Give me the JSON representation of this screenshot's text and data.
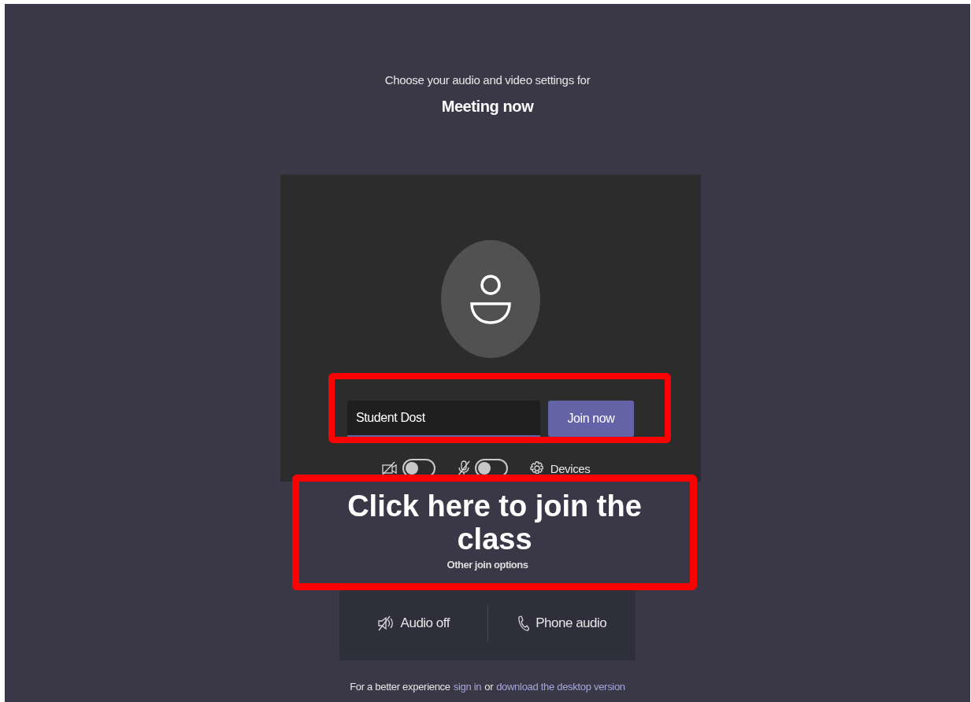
{
  "header": {
    "subtitle": "Choose your audio and video settings for",
    "title": "Meeting now"
  },
  "preview": {
    "name_field": {
      "value": "Student Dost"
    },
    "join_button": "Join now",
    "toggles": [
      {
        "kind": "camera",
        "on": false
      },
      {
        "kind": "mic",
        "on": false
      }
    ],
    "devices_button": "Devices"
  },
  "other_options": {
    "heading": "Other join options",
    "items": [
      {
        "kind": "audio-off",
        "label": "Audio off"
      },
      {
        "kind": "phone",
        "label": "Phone audio"
      }
    ]
  },
  "footer": {
    "text": "For a better experience",
    "link_1": "sign in",
    "middle": "or",
    "link_2": "download the desktop version"
  },
  "annotation": {
    "callout": "Click here to join the class"
  }
}
